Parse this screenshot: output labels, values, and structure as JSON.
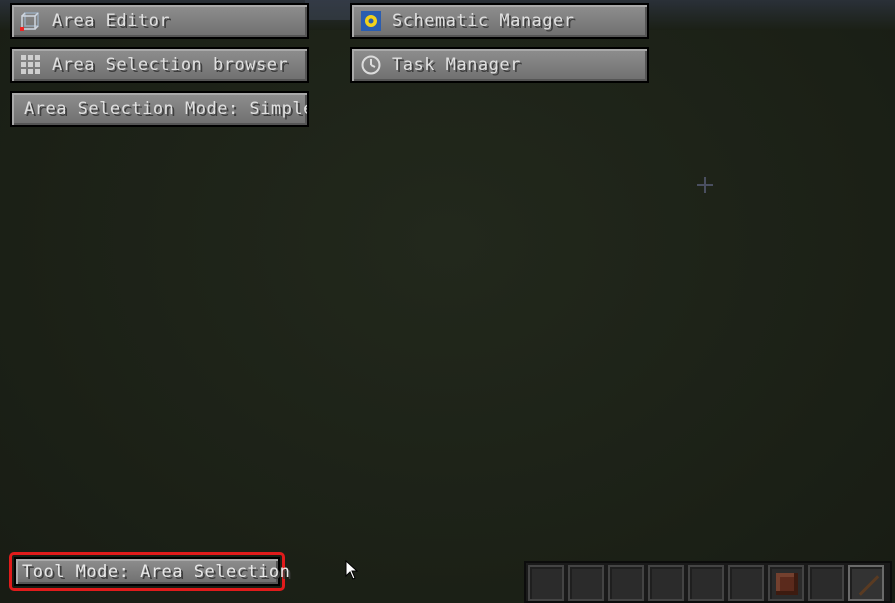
{
  "menu": {
    "area_editor": "Area Editor",
    "area_selection_browser": "Area Selection browser",
    "area_selection_mode": "Area Selection Mode: Simple",
    "schematic_manager": "Schematic Manager",
    "task_manager": "Task Manager"
  },
  "status": {
    "tool_mode": "Tool Mode: Area Selection"
  },
  "icons": {
    "area_editor": "area-cube-icon",
    "area_selection_browser": "grid-icon",
    "schematic_manager": "schematic-icon",
    "task_manager": "clock-icon",
    "crosshair": "crosshair-icon",
    "cursor": "mouse-cursor-icon"
  },
  "hotbar": {
    "slots": 9,
    "selected_slot": 9,
    "items": [
      "",
      "",
      "",
      "",
      "",
      "",
      "dark-red-block",
      "",
      "stick"
    ]
  },
  "colors": {
    "highlight": "#e01b1b",
    "button": "#7a7a7a",
    "background": "#1b2016"
  }
}
